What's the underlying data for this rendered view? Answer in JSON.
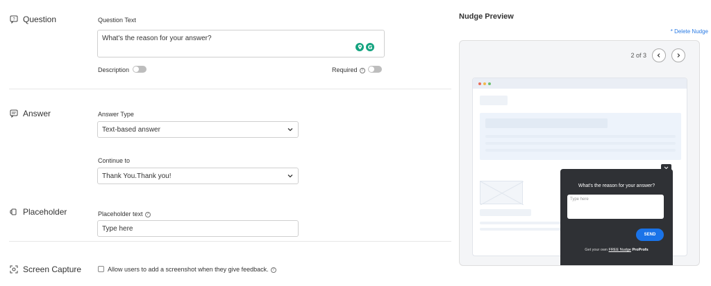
{
  "sections": {
    "question": {
      "title": "Question",
      "text_label": "Question Text",
      "text_value": "What's the reason for your answer?",
      "description_label": "Description",
      "required_label": "Required"
    },
    "answer": {
      "title": "Answer",
      "type_label": "Answer Type",
      "type_value": "Text-based answer",
      "continue_label": "Continue to",
      "continue_value": "Thank You.Thank you!"
    },
    "placeholder": {
      "title": "Placeholder",
      "label": "Placeholder text",
      "value": "Type here"
    },
    "screen_capture": {
      "title": "Screen Capture",
      "checkbox_label": "Allow users to add a screenshot when they give feedback."
    }
  },
  "preview": {
    "title": "Nudge Preview",
    "delete_link": "* Delete Nudge",
    "pager": "2 of 3",
    "nudge_question": "What's the reason for your answer?",
    "nudge_placeholder": "Type here",
    "send_label": "SEND",
    "footer_prefix": "Get your own",
    "footer_link": "FREE Nudge",
    "footer_brand": "ProProfs"
  },
  "icons": {
    "question": "chat-question-icon",
    "answer": "chat-lines-icon",
    "placeholder": "placeholder-icon",
    "screen_capture": "screen-capture-icon",
    "help": "help-circle-icon",
    "chevron": "chevron-down-icon",
    "prev": "chevron-left-icon",
    "next": "chevron-right-icon"
  },
  "colors": {
    "accent": "#1a73e8",
    "link": "#2a7be4",
    "nudge_bg": "#2f3135",
    "grammarly": "#14a37f"
  }
}
